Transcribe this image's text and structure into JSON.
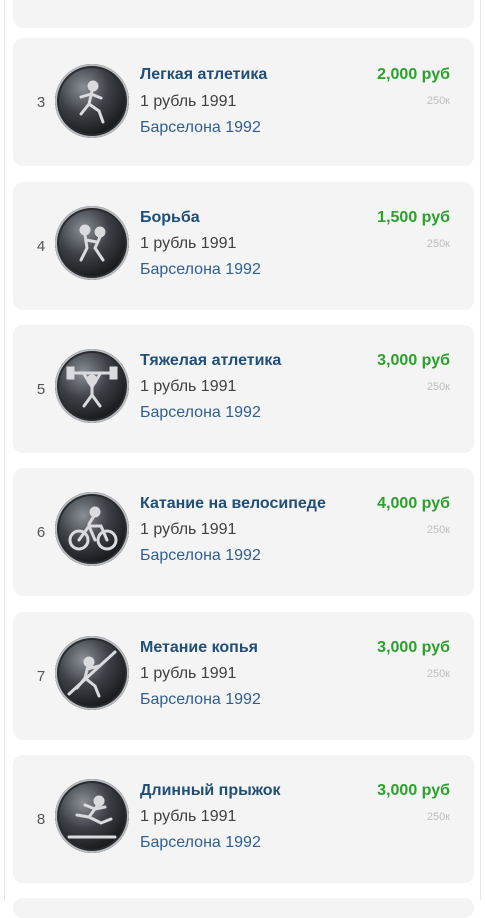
{
  "colors": {
    "title": "#1f4e79",
    "price": "#2aa12a",
    "series": "#2f5f8f",
    "card_bg": "#f4f4f5"
  },
  "coins": [
    {
      "index": "3",
      "title": "Легкая атлетика",
      "denomination": "1 рубль 1991",
      "series": "Барселона 1992",
      "price": "2,000 руб",
      "views": "250к",
      "icon": "runner-coin-icon"
    },
    {
      "index": "4",
      "title": "Борьба",
      "denomination": "1 рубль 1991",
      "series": "Барселона 1992",
      "price": "1,500 руб",
      "views": "250к",
      "icon": "wrestling-coin-icon"
    },
    {
      "index": "5",
      "title": "Тяжелая атлетика",
      "denomination": "1 рубль 1991",
      "series": "Барселона 1992",
      "price": "3,000 руб",
      "views": "250к",
      "icon": "weightlifting-coin-icon"
    },
    {
      "index": "6",
      "title": "Катание на велосипеде",
      "denomination": "1 рубль 1991",
      "series": "Барселона 1992",
      "price": "4,000 руб",
      "views": "250к",
      "icon": "cycling-coin-icon"
    },
    {
      "index": "7",
      "title": "Метание копья",
      "denomination": "1 рубль 1991",
      "series": "Барселона 1992",
      "price": "3,000 руб",
      "views": "250к",
      "icon": "javelin-coin-icon"
    },
    {
      "index": "8",
      "title": "Длинный прыжок",
      "denomination": "1 рубль 1991",
      "series": "Барселона 1992",
      "price": "3,000 руб",
      "views": "250к",
      "icon": "long-jump-coin-icon"
    }
  ]
}
